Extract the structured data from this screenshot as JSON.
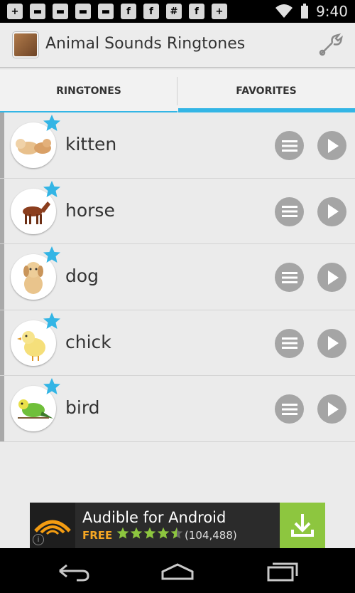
{
  "status_bar": {
    "notification_icons": [
      "plus-box-icon",
      "chat-icon",
      "chat-icon",
      "chat-icon",
      "chat-icon",
      "facebook-icon",
      "facebook-icon",
      "calendar-grid-icon",
      "facebook-icon",
      "add-person-icon"
    ],
    "time": "9:40"
  },
  "action_bar": {
    "title": "Animal Sounds Ringtones",
    "settings_icon": "wrench-icon"
  },
  "tabs": [
    {
      "label": "RINGTONES",
      "selected": false
    },
    {
      "label": "FAVORITES",
      "selected": true
    }
  ],
  "ringtones": [
    {
      "name": "kitten",
      "favorite": true
    },
    {
      "name": "horse",
      "favorite": true
    },
    {
      "name": "dog",
      "favorite": true
    },
    {
      "name": "chick",
      "favorite": true
    },
    {
      "name": "bird",
      "favorite": true
    }
  ],
  "ad": {
    "title": "Audible for Android",
    "price": "FREE",
    "rating_stars": 4,
    "review_count": "(104,488)",
    "info_label": "i"
  },
  "colors": {
    "accent": "#33b5e5",
    "star": "#33b5e5",
    "button_gray": "#a5a5a5",
    "ad_green": "#8dc63f",
    "ad_orange": "#f5a623"
  },
  "nav_bar": [
    "back-icon",
    "home-icon",
    "recent-apps-icon"
  ]
}
